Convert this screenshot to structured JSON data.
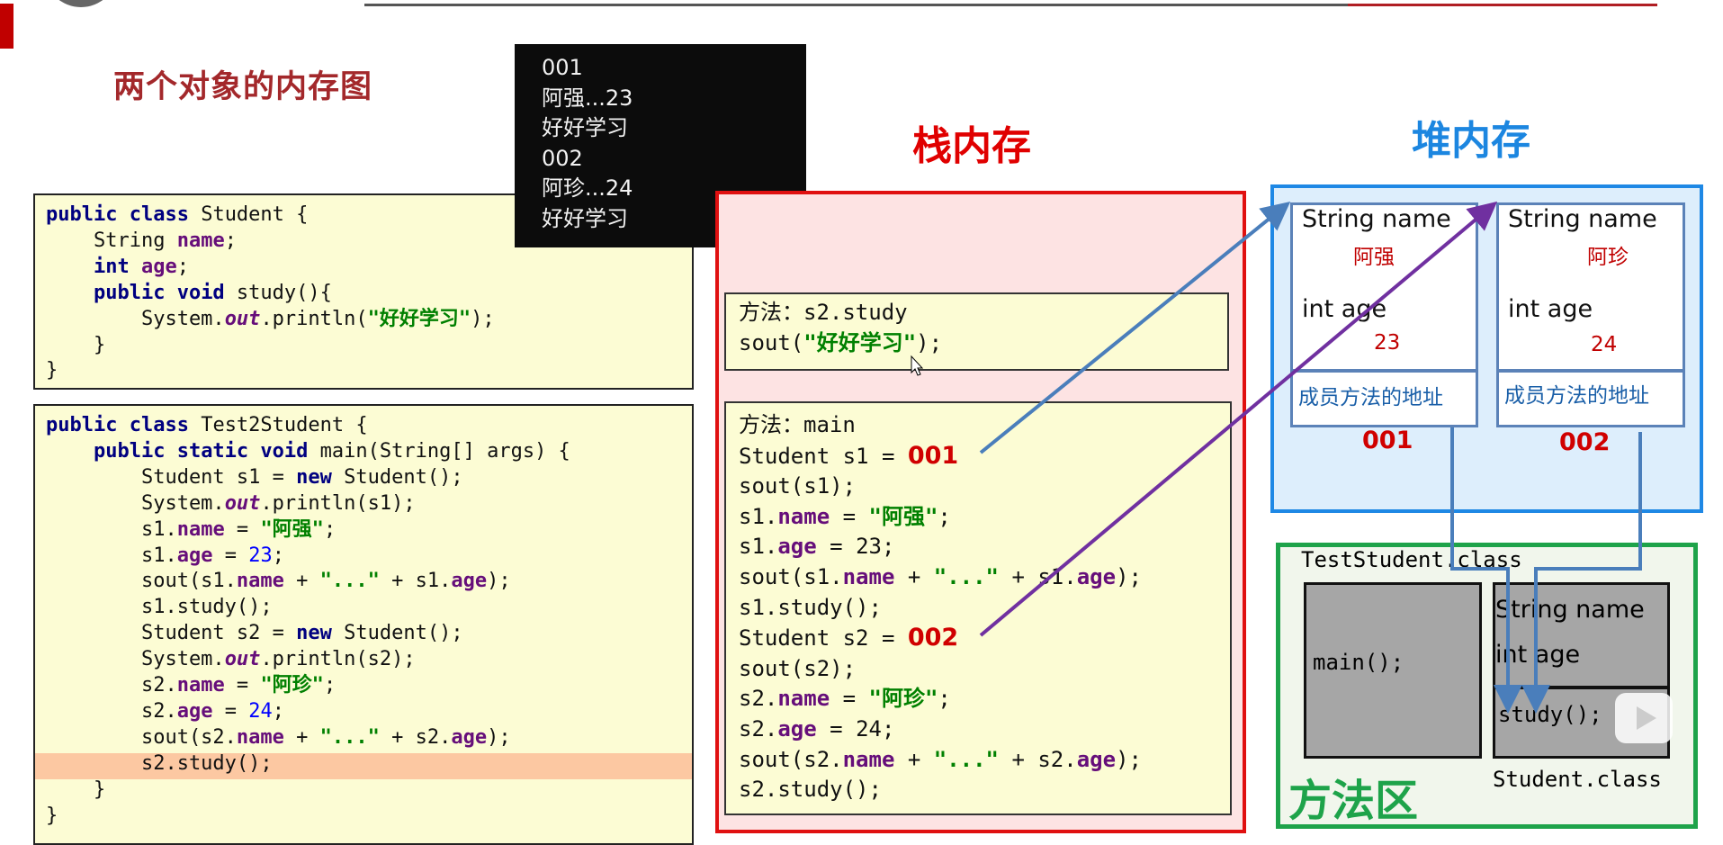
{
  "slide_title": "两个对象的内存图",
  "console_output": [
    "001",
    "阿强...23",
    "好好学习",
    "002",
    "阿珍...24",
    "好好学习"
  ],
  "student_code": [
    [
      [
        "public class",
        "kw"
      ],
      [
        " Student {",
        ""
      ]
    ],
    [
      [
        "    String ",
        ""
      ],
      [
        "name",
        "fld"
      ],
      [
        ";",
        ""
      ]
    ],
    [
      [
        "    ",
        ""
      ],
      [
        "int",
        "kw"
      ],
      [
        " ",
        ""
      ],
      [
        "age",
        "fld"
      ],
      [
        ";",
        ""
      ]
    ],
    [
      [
        "    ",
        ""
      ],
      [
        "public void",
        "kw"
      ],
      [
        " study(){",
        ""
      ]
    ],
    [
      [
        "        System.",
        ""
      ],
      [
        "out",
        "out"
      ],
      [
        ".println(",
        ""
      ],
      [
        "\"好好学习\"",
        "str"
      ],
      [
        ");",
        ""
      ]
    ],
    [
      [
        "    }",
        ""
      ]
    ],
    [
      [
        "}",
        ""
      ]
    ]
  ],
  "test_code": [
    [
      [
        "public class",
        "kw"
      ],
      [
        " Test2Student {",
        ""
      ]
    ],
    [
      [
        "    ",
        ""
      ],
      [
        "public static void",
        "kw"
      ],
      [
        " main(String[] args) {",
        ""
      ]
    ],
    [
      [
        "        Student s1 = ",
        ""
      ],
      [
        "new",
        "kw"
      ],
      [
        " Student();",
        ""
      ]
    ],
    [
      [
        "        System.",
        ""
      ],
      [
        "out",
        "out"
      ],
      [
        ".println(s1);",
        ""
      ]
    ],
    [
      [
        "        s1.",
        ""
      ],
      [
        "name",
        "fld"
      ],
      [
        " = ",
        ""
      ],
      [
        "\"阿强\"",
        "str"
      ],
      [
        ";",
        ""
      ]
    ],
    [
      [
        "        s1.",
        ""
      ],
      [
        "age",
        "fld"
      ],
      [
        " = ",
        ""
      ],
      [
        "23",
        "num"
      ],
      [
        ";",
        ""
      ]
    ],
    [
      [
        "        sout(s1.",
        ""
      ],
      [
        "name",
        "fld"
      ],
      [
        " + ",
        ""
      ],
      [
        "\"...\"",
        "str"
      ],
      [
        " + s1.",
        ""
      ],
      [
        "age",
        "fld"
      ],
      [
        ");",
        ""
      ]
    ],
    [
      [
        "        s1.study();",
        ""
      ]
    ],
    [
      [
        "        Student s2 = ",
        ""
      ],
      [
        "new",
        "kw"
      ],
      [
        " Student();",
        ""
      ]
    ],
    [
      [
        "        System.",
        ""
      ],
      [
        "out",
        "out"
      ],
      [
        ".println(s2);",
        ""
      ]
    ],
    [
      [
        "        s2.",
        ""
      ],
      [
        "name",
        "fld"
      ],
      [
        " = ",
        ""
      ],
      [
        "\"阿珍\"",
        "str"
      ],
      [
        ";",
        ""
      ]
    ],
    [
      [
        "        s2.",
        ""
      ],
      [
        "age",
        "fld"
      ],
      [
        " = ",
        ""
      ],
      [
        "24",
        "num"
      ],
      [
        ";",
        ""
      ]
    ],
    [
      [
        "        sout(s2.",
        ""
      ],
      [
        "name",
        "fld"
      ],
      [
        " + ",
        ""
      ],
      [
        "\"...\"",
        "str"
      ],
      [
        " + s2.",
        ""
      ],
      [
        "age",
        "fld"
      ],
      [
        ");",
        ""
      ]
    ],
    [
      [
        "        s2.study();",
        ""
      ]
    ],
    [
      [
        "    }",
        ""
      ]
    ],
    [
      [
        "}",
        ""
      ]
    ]
  ],
  "stack": {
    "title": "栈内存",
    "study_frame": [
      [
        [
          "方法：s2.study",
          ""
        ]
      ],
      [
        [
          "sout(",
          ""
        ],
        [
          "\"好好学习\"",
          "str"
        ],
        [
          ");",
          ""
        ]
      ]
    ],
    "main_frame": [
      [
        [
          "方法：main",
          ""
        ]
      ],
      [
        [
          "Student s1 = ",
          ""
        ],
        [
          "001",
          "addr"
        ]
      ],
      [
        [
          "sout(s1);",
          ""
        ]
      ],
      [
        [
          "s1.",
          ""
        ],
        [
          "name",
          "fld"
        ],
        [
          " = ",
          ""
        ],
        [
          "\"阿强\"",
          "str"
        ],
        [
          ";",
          ""
        ]
      ],
      [
        [
          "s1.",
          ""
        ],
        [
          "age",
          "fld"
        ],
        [
          " = 23;",
          ""
        ]
      ],
      [
        [
          "sout(s1.",
          ""
        ],
        [
          "name",
          "fld"
        ],
        [
          " + ",
          ""
        ],
        [
          "\"...\"",
          "str"
        ],
        [
          " + s1.",
          ""
        ],
        [
          "age",
          "fld"
        ],
        [
          ");",
          ""
        ]
      ],
      [
        [
          "s1.study();",
          ""
        ]
      ],
      [
        [
          "Student s2 = ",
          ""
        ],
        [
          "002",
          "addr"
        ]
      ],
      [
        [
          "sout(s2);",
          ""
        ]
      ],
      [
        [
          "s2.",
          ""
        ],
        [
          "name",
          "fld"
        ],
        [
          " = ",
          ""
        ],
        [
          "\"阿珍\"",
          "str"
        ],
        [
          ";",
          ""
        ]
      ],
      [
        [
          "s2.",
          ""
        ],
        [
          "age",
          "fld"
        ],
        [
          " = 24;",
          ""
        ]
      ],
      [
        [
          "sout(s2.",
          ""
        ],
        [
          "name",
          "fld"
        ],
        [
          " + ",
          ""
        ],
        [
          "\"...\"",
          "str"
        ],
        [
          " + s2.",
          ""
        ],
        [
          "age",
          "fld"
        ],
        [
          ");",
          ""
        ]
      ],
      [
        [
          "s2.study();",
          ""
        ]
      ]
    ]
  },
  "heap": {
    "title": "堆内存",
    "objects": [
      {
        "name_label": "String name",
        "name_value": "阿强",
        "age_label": "int age",
        "age_value": "23",
        "method_label": "成员方法的地址",
        "address": "001"
      },
      {
        "name_label": "String name",
        "name_value": "阿珍",
        "age_label": "int age",
        "age_value": "24",
        "method_label": "成员方法的地址",
        "address": "002"
      }
    ]
  },
  "method_area": {
    "title": "方法区",
    "test_class_label": "TestStudent.class",
    "test_class_method": "main();",
    "student_class_label": "Student.class",
    "student_fields": [
      "String name",
      "int age"
    ],
    "student_method": "study();"
  },
  "colors": {
    "stack": "#e01010",
    "heap": "#1e88e5",
    "method_area": "#1ea34a",
    "arrow_s1": "#4a7ebb",
    "arrow_s2": "#7030a0"
  },
  "icons": [
    "cursor-icon",
    "bilibili-logo-icon"
  ]
}
